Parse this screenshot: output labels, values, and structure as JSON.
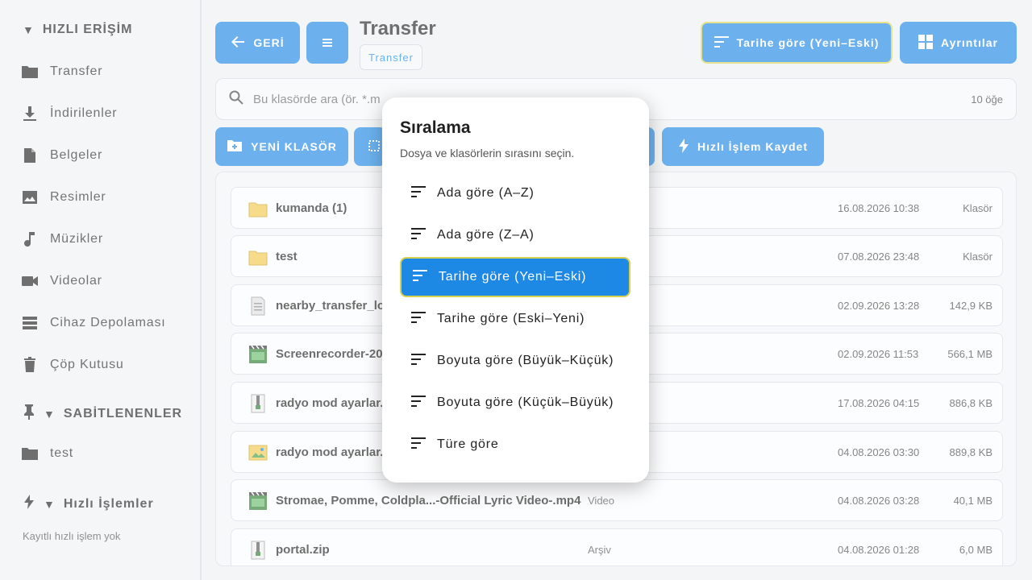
{
  "sidebar": {
    "quick_access_header": "HIZLI ERİŞİM",
    "quick_items": [
      {
        "label": "Transfer",
        "icon": "folder-icon"
      },
      {
        "label": "İndirilenler",
        "icon": "download-icon"
      },
      {
        "label": "Belgeler",
        "icon": "document-icon"
      },
      {
        "label": "Resimler",
        "icon": "image-icon"
      },
      {
        "label": "Müzikler",
        "icon": "music-note-icon"
      },
      {
        "label": "Videolar",
        "icon": "video-camera-icon"
      },
      {
        "label": "Cihaz Depolaması",
        "icon": "storage-icon"
      },
      {
        "label": "Çöp Kutusu",
        "icon": "trash-icon"
      }
    ],
    "pinned_header": "SABİTLENENLER",
    "pinned_items": [
      {
        "label": "test",
        "icon": "folder-icon"
      }
    ],
    "quick_actions_header": "Hızlı İşlemler",
    "quick_actions_empty": "Kayıtlı hızlı işlem yok"
  },
  "toolbar": {
    "back_label": "GERİ",
    "title": "Transfer",
    "breadcrumb": "Transfer",
    "sort_label": "Tarihe göre (Yeni–Eski)",
    "details_label": "Ayrıntılar",
    "new_folder_label": "YENİ KLASÖR",
    "quick_save_label": "Hızlı İşlem Kaydet"
  },
  "search": {
    "placeholder": "Bu klasörde ara (ör. *.m",
    "count": "10 öğe"
  },
  "files": [
    {
      "name": "kumanda (1)",
      "type": "",
      "date": "16.08.2026 10:38",
      "size": "Klasör",
      "icon": "folder-icon"
    },
    {
      "name": "test",
      "type": "",
      "date": "07.08.2026 23:48",
      "size": "Klasör",
      "icon": "folder-icon"
    },
    {
      "name": "nearby_transfer_lo",
      "type": "",
      "date": "02.09.2026 13:28",
      "size": "142,9 KB",
      "icon": "text-file-icon"
    },
    {
      "name": "Screenrecorder-20",
      "type": "",
      "date": "02.09.2026 11:53",
      "size": "566,1 MB",
      "icon": "video-file-icon"
    },
    {
      "name": "radyo mod ayarlar.",
      "type": "",
      "date": "17.08.2026 04:15",
      "size": "886,8 KB",
      "icon": "archive-icon"
    },
    {
      "name": "radyo mod ayarlar.",
      "type": "",
      "date": "04.08.2026 03:30",
      "size": "889,8 KB",
      "icon": "image-file-icon"
    },
    {
      "name": "Stromae, Pomme, Coldpla...-Official Lyric Video-.mp4",
      "type": "Video",
      "date": "04.08.2026 03:28",
      "size": "40,1 MB",
      "icon": "video-file-icon"
    },
    {
      "name": "portal.zip",
      "type": "Arşiv",
      "date": "04.08.2026 01:28",
      "size": "6,0 MB",
      "icon": "archive-icon"
    }
  ],
  "dialog": {
    "title": "Sıralama",
    "subtitle": "Dosya ve klasörlerin sırasını seçin.",
    "options": [
      {
        "label": "Ada göre (A–Z)",
        "selected": false
      },
      {
        "label": "Ada göre (Z–A)",
        "selected": false
      },
      {
        "label": "Tarihe göre (Yeni–Eski)",
        "selected": true
      },
      {
        "label": "Tarihe göre (Eski–Yeni)",
        "selected": false
      },
      {
        "label": "Boyuta göre (Büyük–Küçük)",
        "selected": false
      },
      {
        "label": "Boyuta göre (Küçük–Büyük)",
        "selected": false
      },
      {
        "label": "Türe göre",
        "selected": false
      }
    ]
  },
  "colors": {
    "accent": "#1e88e5",
    "selected_border": "#d8d250",
    "folder": "#f2c94c"
  }
}
